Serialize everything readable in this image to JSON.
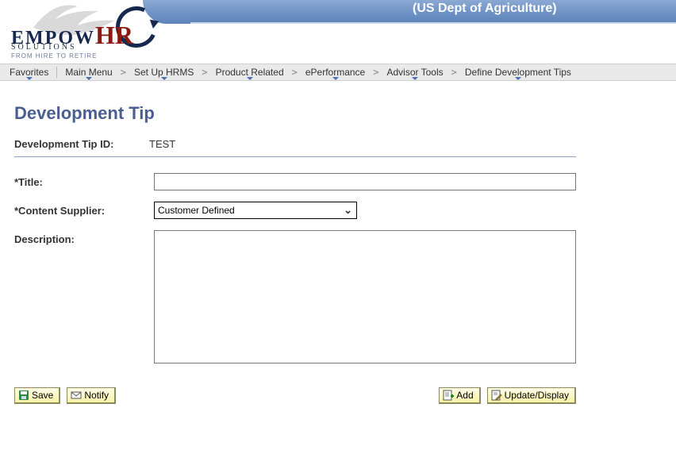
{
  "header": {
    "banner_text": "(US Dept of Agriculture)",
    "logo": {
      "word1": "EMPOW",
      "word2": "HR",
      "subtitle": "SOLUTIONS",
      "tagline": "FROM HIRE TO RETIRE"
    }
  },
  "nav": {
    "favorites": "Favorites",
    "crumbs": [
      "Main Menu",
      "Set Up HRMS",
      "Product Related",
      "ePerformance",
      "Advisor Tools",
      "Define Development Tips"
    ]
  },
  "page": {
    "title": "Development Tip",
    "id_label": "Development Tip ID:",
    "id_value": "TEST",
    "fields": {
      "title_label": "*Title:",
      "title_value": "",
      "supplier_label": "*Content Supplier:",
      "supplier_selected": "Customer Defined",
      "description_label": "Description:",
      "description_value": ""
    }
  },
  "toolbar": {
    "save": "Save",
    "notify": "Notify",
    "add": "Add",
    "update": "Update/Display"
  }
}
